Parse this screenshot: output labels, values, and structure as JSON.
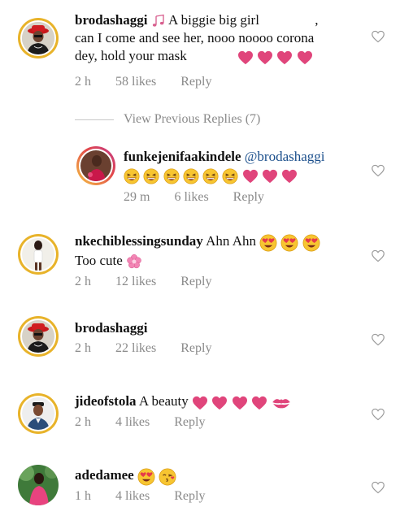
{
  "comments": [
    {
      "username": "brodashaggi",
      "text_line1": "A biggie big girl",
      "text_line1_tail": ",",
      "text_line2": "can I come and see her, nooo noooo corona",
      "text_line3": "dey, hold your mask",
      "time": "2 h",
      "likes": "58 likes",
      "reply": "Reply"
    },
    {
      "username": "funkejenifaakindele",
      "mention": "@brodashaggi",
      "time": "29 m",
      "likes": "6 likes",
      "reply": "Reply"
    },
    {
      "username": "nkechiblessingsunday",
      "text": "Ahn Ahn",
      "text_line2": "Too cute",
      "time": "2 h",
      "likes": "12 likes",
      "reply": "Reply"
    },
    {
      "username": "brodashaggi",
      "time": "2 h",
      "likes": "22 likes",
      "reply": "Reply"
    },
    {
      "username": "jideofstola",
      "text": "A beauty",
      "time": "2 h",
      "likes": "4 likes",
      "reply": "Reply"
    },
    {
      "username": "adedamee",
      "time": "1 h",
      "likes": "4 likes",
      "reply": "Reply"
    }
  ],
  "view_previous": "View Previous Replies (7)",
  "icons": {
    "like": "heart-outline-icon",
    "heart_emoji": "pink-heart-emoji",
    "laugh_emoji": "grinning-squinting-face-emoji",
    "heart_eyes_emoji": "smiling-face-with-heart-eyes-emoji",
    "blossom_emoji": "cherry-blossom-emoji",
    "kiss_emoji": "kiss-mark-emoji",
    "music_emoji": "musical-notes-emoji"
  },
  "colors": {
    "heart": "#e0457b",
    "meta": "#8a8a8a",
    "mention": "#1b4f8c",
    "ring": "#e8b32a"
  }
}
